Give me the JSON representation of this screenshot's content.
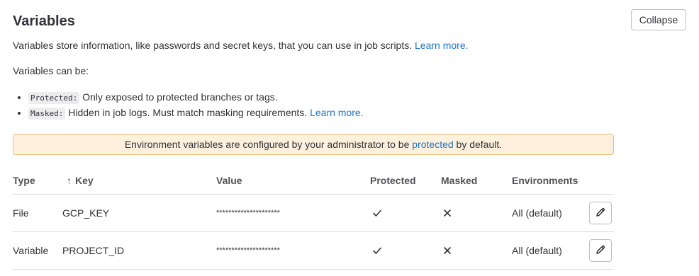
{
  "section": {
    "title": "Variables",
    "collapse_label": "Collapse",
    "description": "Variables store information, like passwords and secret keys, that you can use in job scripts.",
    "learn_more": "Learn more.",
    "can_be": "Variables can be:",
    "options": [
      {
        "code": "Protected:",
        "text": "Only exposed to protected branches or tags.",
        "link": ""
      },
      {
        "code": "Masked:",
        "text": "Hidden in job logs. Must match masking requirements.",
        "link": "Learn more."
      }
    ]
  },
  "alert": {
    "before": "Environment variables are configured by your administrator to be",
    "link": "protected",
    "after": "by default."
  },
  "table": {
    "headers": {
      "type": "Type",
      "sort_arrow": "↑",
      "key": "Key",
      "value": "Value",
      "protected": "Protected",
      "masked": "Masked",
      "environments": "Environments"
    },
    "rows": [
      {
        "type": "File",
        "key": "GCP_KEY",
        "value": "*********************",
        "protected": "check-icon",
        "masked": "close-icon",
        "environment": "All (default)"
      },
      {
        "type": "Variable",
        "key": "PROJECT_ID",
        "value": "*********************",
        "protected": "check-icon",
        "masked": "close-icon",
        "environment": "All (default)"
      }
    ]
  },
  "colors": {
    "link": "#1f75cb",
    "alert_bg": "#fdf1dd",
    "alert_border": "#e9be74",
    "text": "#333238"
  }
}
